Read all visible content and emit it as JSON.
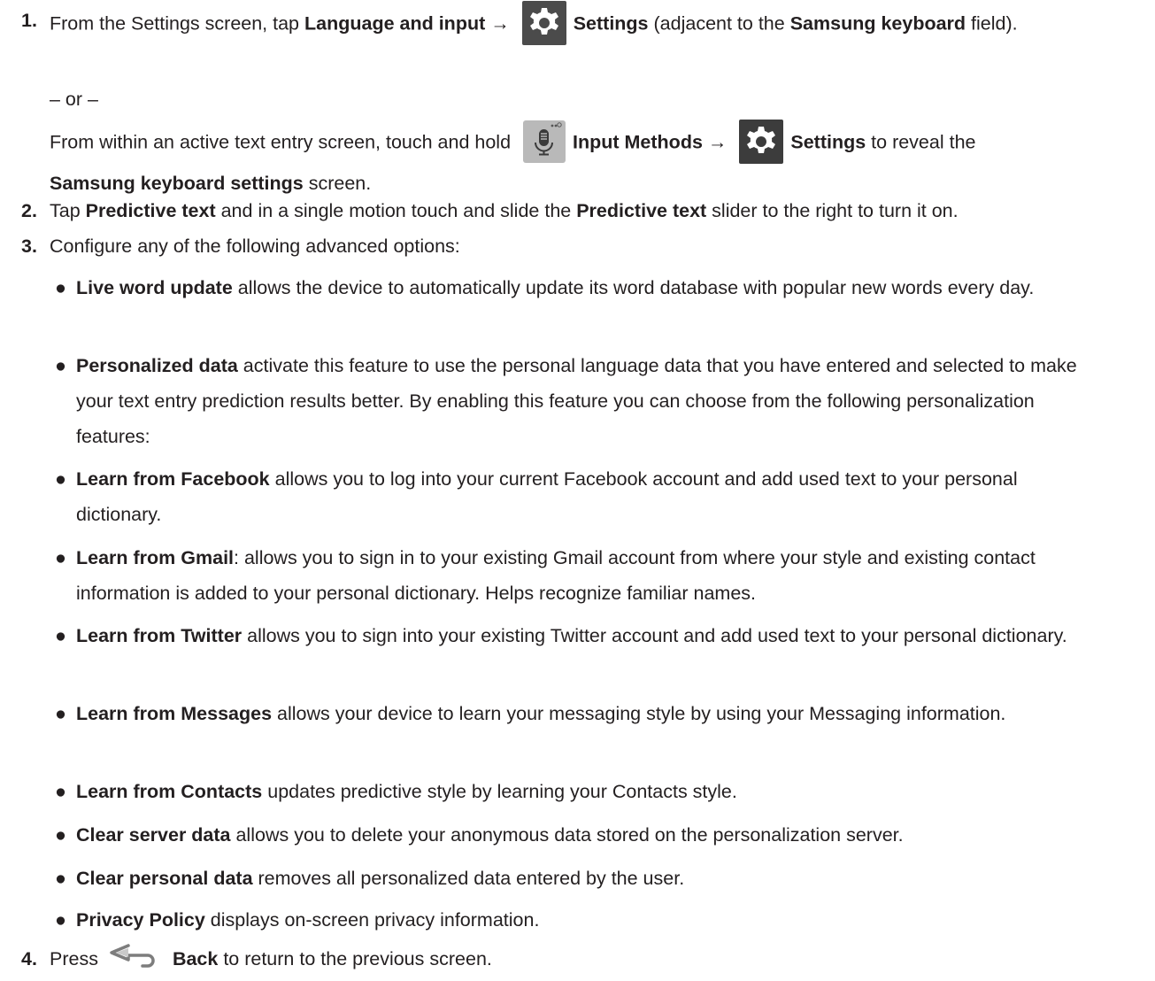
{
  "icons": [
    "gear-icon",
    "microphone-icon",
    "back-arrow-icon"
  ],
  "step1": {
    "num": "1.",
    "a1": "From the Settings screen, tap ",
    "b1": "Language and input",
    "a2": " → ",
    "b2": "Settings",
    "a3": " (adjacent to the ",
    "b3": "Samsung keyboard",
    "a4": " field).",
    "or": "– or –",
    "c1": "From within an active text entry screen, touch and hold ",
    "d1": "Input Methods",
    "c2": " → ",
    "d2": "Settings",
    "c3": " to reveal the ",
    "d3": "Samsung keyboard settings",
    "c4": " screen."
  },
  "step2": {
    "num": "2.",
    "a1": "Tap ",
    "b1": "Predictive text",
    "a2": " and in a single motion touch and slide the ",
    "b2": "Predictive text",
    "a3": " slider to the right to turn it on."
  },
  "step3": {
    "num": "3.",
    "text": "Configure any of the following advanced options:",
    "bullets": [
      {
        "term": "Live word update",
        "desc": " allows the device to automatically update its word database with popular new words every day."
      },
      {
        "term": "Personalized data",
        "desc": " activate this feature to use the personal language data that you have entered and selected to make your text entry prediction results better. By enabling this feature you can choose from the following personalization features:"
      },
      {
        "term": "Learn from Facebook",
        "desc": " allows you to log into your current Facebook account and add used text to your personal dictionary."
      },
      {
        "term": "Learn from Gmail",
        "desc": ": allows you to sign in to your existing Gmail account from where your style and existing contact information is added to your personal dictionary. Helps recognize familiar names."
      },
      {
        "term": "Learn from Twitter",
        "desc": " allows you to sign into your existing Twitter account and add used text to your personal dictionary."
      },
      {
        "term": "Learn from Messages",
        "desc": " allows your device to learn your messaging style by using your Messaging information."
      },
      {
        "term": "Learn from Contacts",
        "desc": " updates predictive style by learning your Contacts style."
      },
      {
        "term": "Clear server data",
        "desc": " allows you to delete your anonymous data stored on the personalization server."
      },
      {
        "term": "Clear personal data",
        "desc": " removes all personalized data entered by the user."
      },
      {
        "term": "Privacy Policy",
        "desc": " displays on-screen privacy information."
      }
    ]
  },
  "step4": {
    "num": "4.",
    "a1": "Press ",
    "b1": "Back",
    "a2": " to return to the previous screen."
  }
}
